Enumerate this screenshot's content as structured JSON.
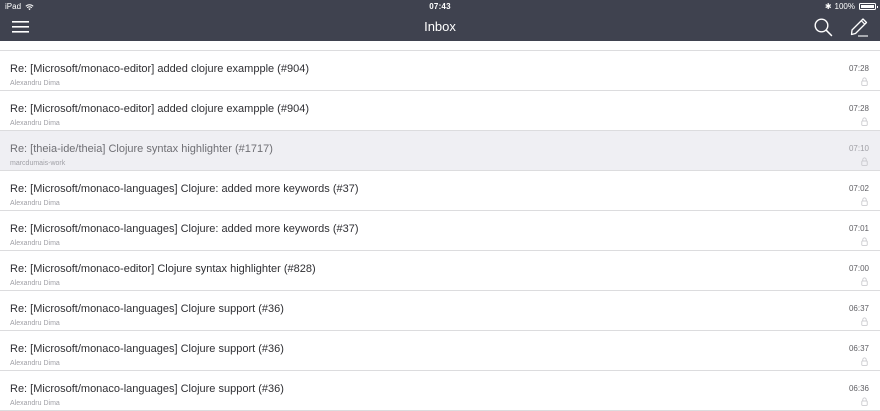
{
  "status_bar": {
    "device": "iPad",
    "time": "07:43",
    "bluetooth": "✱",
    "battery": "100%"
  },
  "nav": {
    "title": "Inbox",
    "icons": [
      "menu-icon",
      "search-icon",
      "compose-icon"
    ]
  },
  "colors": {
    "header_bg": "#3f424f",
    "row_selected_bg": "#efeff3",
    "divider": "#dcdcde"
  },
  "messages": [
    {
      "subject": "Re: [Microsoft/monaco-editor] added clojure exampple (#904)",
      "sender": "Alexandru Dima",
      "time": "07:28",
      "read": false
    },
    {
      "subject": "Re: [Microsoft/monaco-editor] added clojure exampple (#904)",
      "sender": "Alexandru Dima",
      "time": "07:28",
      "read": false
    },
    {
      "subject": "Re: [theia-ide/theia] Clojure syntax highlighter (#1717)",
      "sender": "marcdumais-work",
      "time": "07:10",
      "read": true
    },
    {
      "subject": "Re: [Microsoft/monaco-languages] Clojure: added more keywords (#37)",
      "sender": "Alexandru Dima",
      "time": "07:02",
      "read": false
    },
    {
      "subject": "Re: [Microsoft/monaco-languages] Clojure: added more keywords (#37)",
      "sender": "Alexandru Dima",
      "time": "07:01",
      "read": false
    },
    {
      "subject": "Re: [Microsoft/monaco-editor] Clojure syntax highlighter (#828)",
      "sender": "Alexandru Dima",
      "time": "07:00",
      "read": false
    },
    {
      "subject": "Re: [Microsoft/monaco-languages] Clojure support (#36)",
      "sender": "Alexandru Dima",
      "time": "06:37",
      "read": false
    },
    {
      "subject": "Re: [Microsoft/monaco-languages] Clojure support (#36)",
      "sender": "Alexandru Dima",
      "time": "06:37",
      "read": false
    },
    {
      "subject": "Re: [Microsoft/monaco-languages] Clojure support (#36)",
      "sender": "Alexandru Dima",
      "time": "06:36",
      "read": false
    }
  ]
}
